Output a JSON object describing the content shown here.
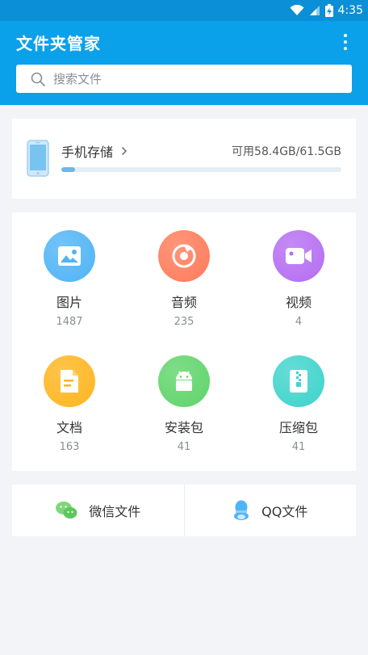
{
  "status_bar": {
    "time": "4:35"
  },
  "header": {
    "title": "文件夹管家",
    "search_placeholder": "搜索文件"
  },
  "storage": {
    "title": "手机存储",
    "usage_text": "可用58.4GB/61.5GB",
    "used_fraction": 0.05
  },
  "categories": [
    {
      "label": "图片",
      "count": "1487",
      "icon": "image-icon",
      "color": "#4fb4f6"
    },
    {
      "label": "音频",
      "count": "235",
      "icon": "music-icon",
      "color": "#ff7b5a"
    },
    {
      "label": "视频",
      "count": "4",
      "icon": "video-icon",
      "color": "#b56df2"
    },
    {
      "label": "文档",
      "count": "163",
      "icon": "document-icon",
      "color": "#ffb51f"
    },
    {
      "label": "安装包",
      "count": "41",
      "icon": "android-icon",
      "color": "#5fd46a"
    },
    {
      "label": "压缩包",
      "count": "41",
      "icon": "zip-icon",
      "color": "#3fd3cc"
    }
  ],
  "social": {
    "wechat_label": "微信文件",
    "qq_label": "QQ文件"
  }
}
